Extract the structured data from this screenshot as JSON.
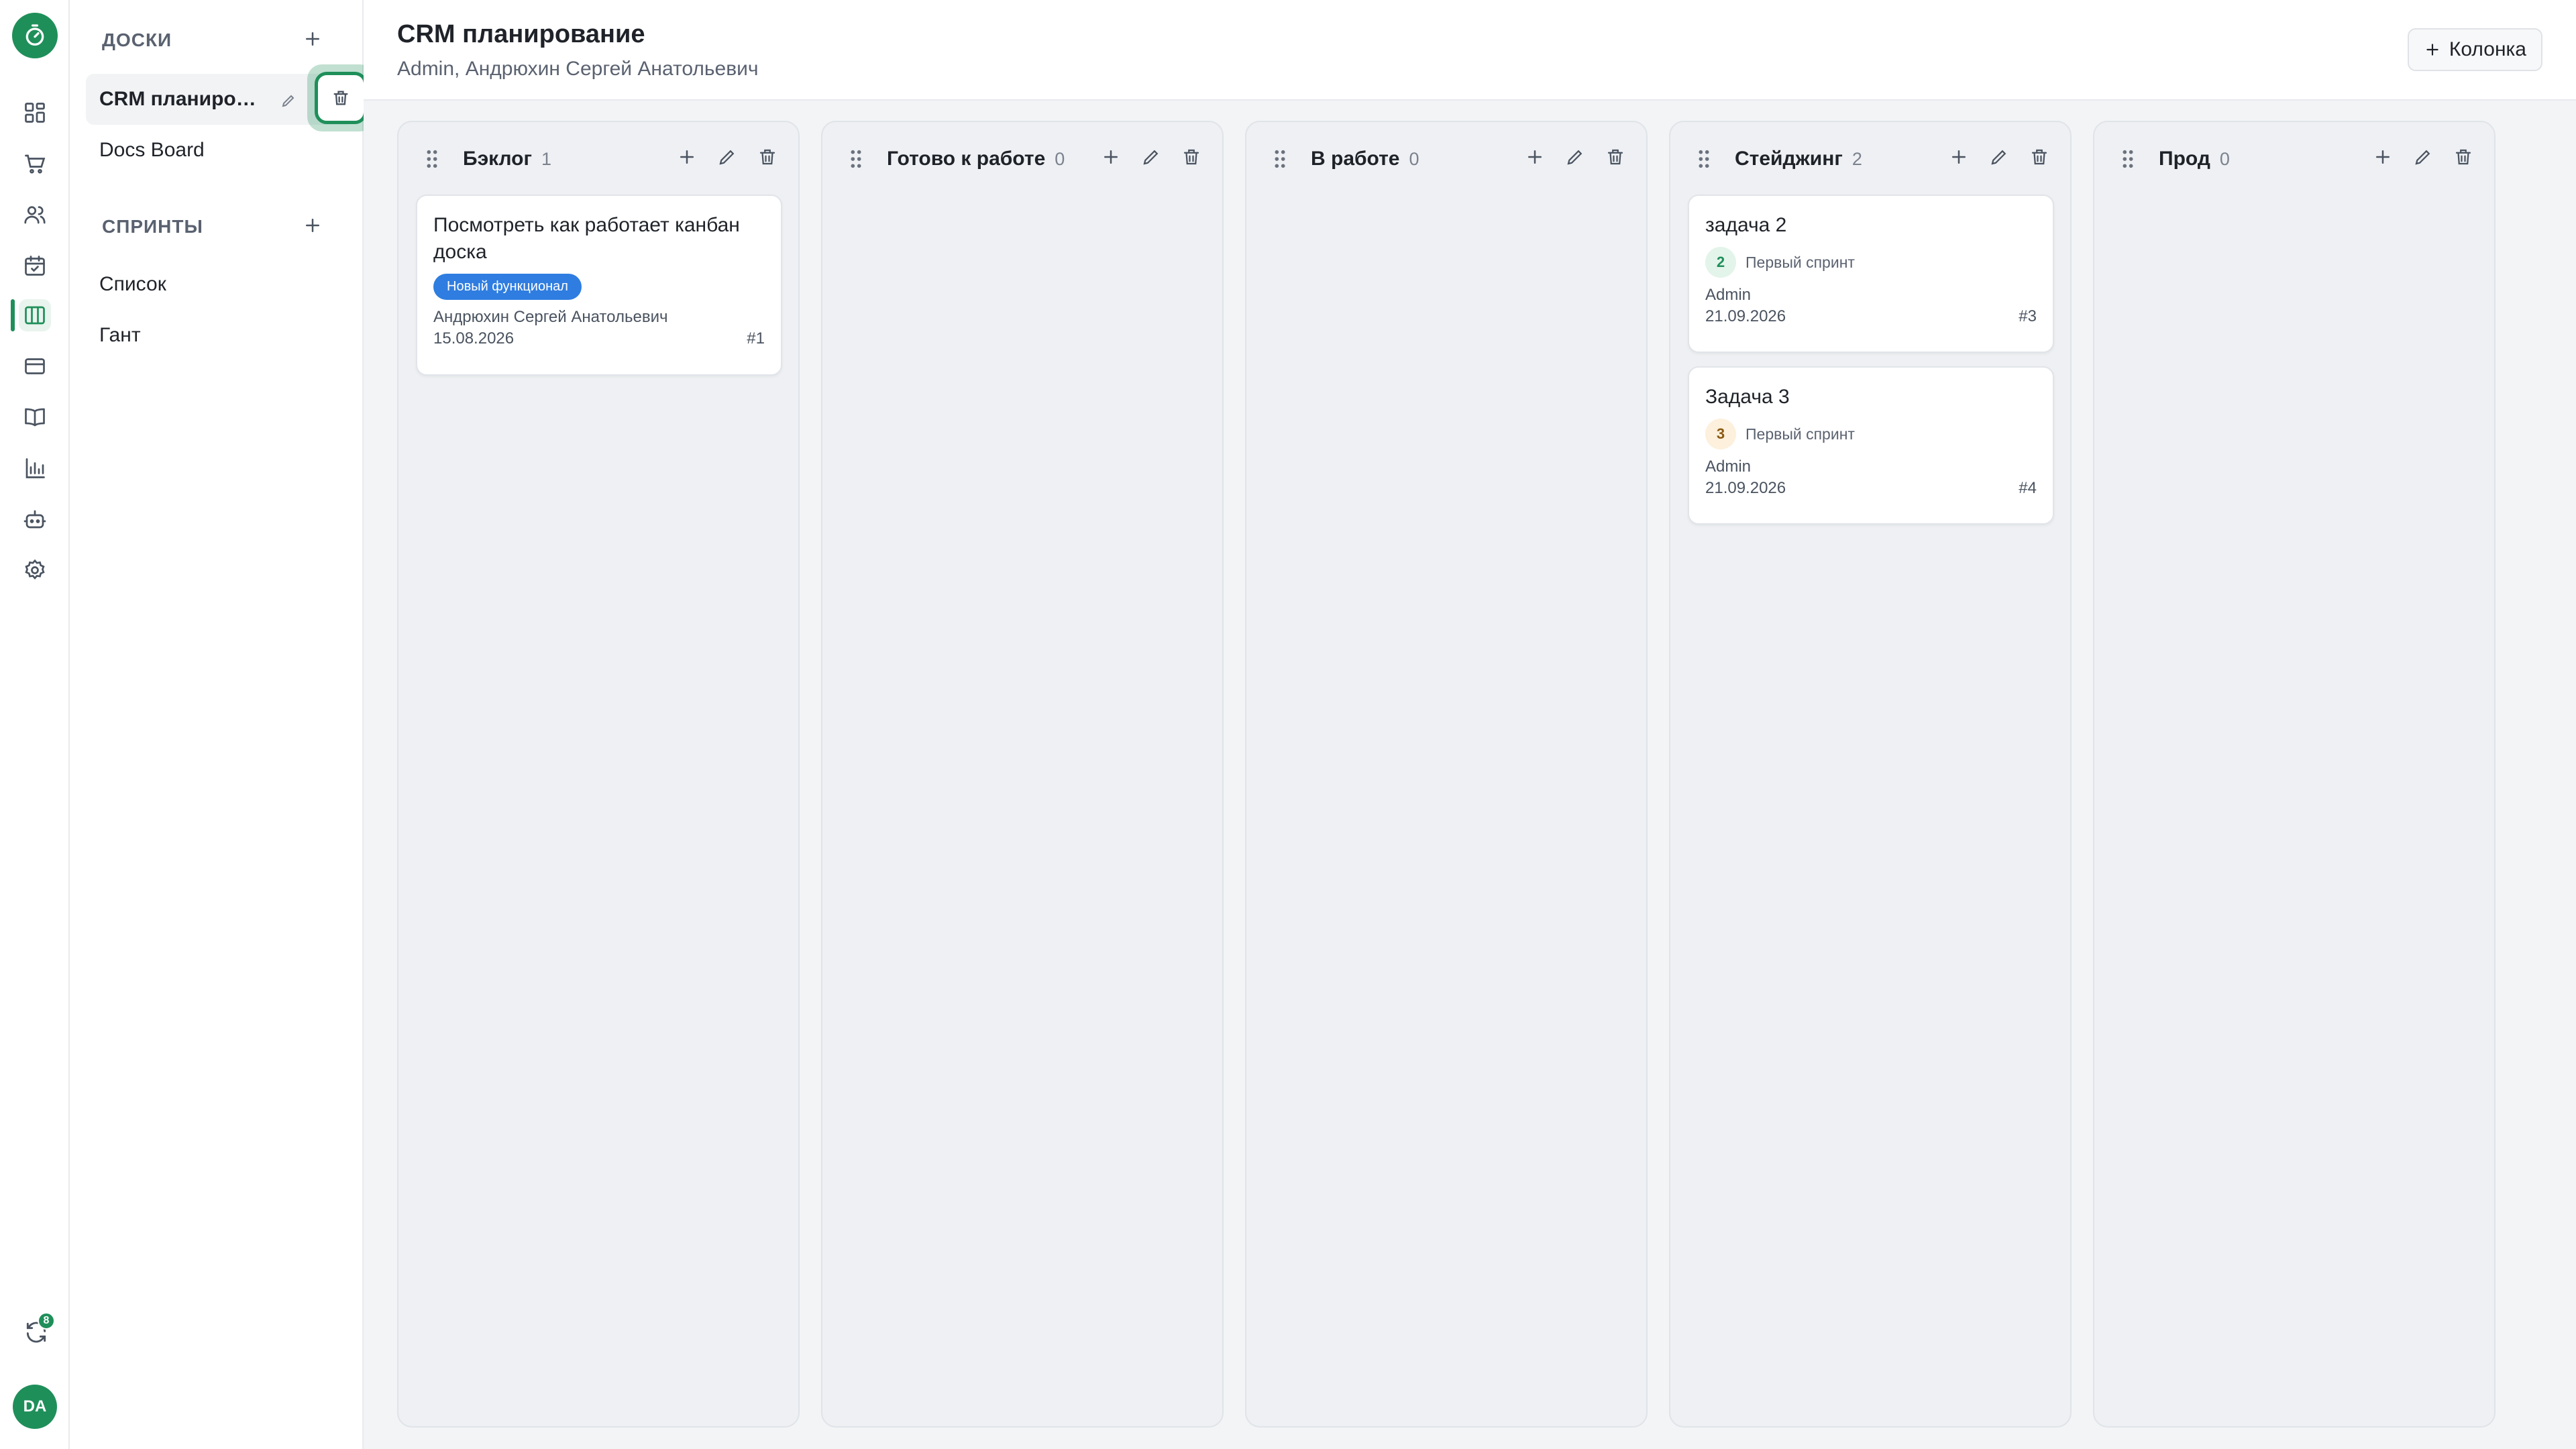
{
  "rail": {
    "logo": "timer-logo-icon",
    "items": [
      {
        "icon": "dashboard-icon"
      },
      {
        "icon": "cart-icon"
      },
      {
        "icon": "users-icon"
      },
      {
        "icon": "calendar-check-icon"
      },
      {
        "icon": "kanban-icon",
        "active": true
      },
      {
        "icon": "card-icon"
      },
      {
        "icon": "book-icon"
      },
      {
        "icon": "bar-chart-icon"
      },
      {
        "icon": "bot-icon"
      },
      {
        "icon": "gear-icon"
      }
    ],
    "sync_badge": "8",
    "avatar_initials": "DA"
  },
  "sidebar": {
    "boards_title": "ДОСКИ",
    "boards": [
      {
        "label": "CRM планирование",
        "selected": true
      },
      {
        "label": "Docs Board",
        "selected": false
      }
    ],
    "sprints_title": "СПРИНТЫ",
    "sprint_links": [
      {
        "label": "Список"
      },
      {
        "label": "Гант"
      }
    ]
  },
  "header": {
    "title": "CRM планирование",
    "subtitle": "Admin, Андрюхин Сергей Анатольевич",
    "add_column_label": "Колонка"
  },
  "columns": [
    {
      "title": "Бэклог",
      "count": "1",
      "cards": [
        {
          "title": "Посмотреть как работает канбан доска",
          "tag": "Новый функционал",
          "assignee": "Андрюхин Сергей Анатольевич",
          "date": "15.08.2026",
          "number": "#1"
        }
      ]
    },
    {
      "title": "Готово к работе",
      "count": "0",
      "cards": []
    },
    {
      "title": "В работе",
      "count": "0",
      "cards": []
    },
    {
      "title": "Стейджинг",
      "count": "2",
      "cards": [
        {
          "title": "задача 2",
          "sprint_badge": "2",
          "sprint_color": "#e3f4ea",
          "sprint_text_color": "#1f8f5a",
          "sprint_name": "Первый спринт",
          "assignee": "Admin",
          "date": "21.09.2026",
          "number": "#3"
        },
        {
          "title": "Задача 3",
          "sprint_badge": "3",
          "sprint_color": "#fdf0dc",
          "sprint_text_color": "#8a5a12",
          "sprint_name": "Первый спринт",
          "assignee": "Admin",
          "date": "21.09.2026",
          "number": "#4"
        }
      ]
    },
    {
      "title": "Прод",
      "count": "0",
      "cards": []
    }
  ],
  "colors": {
    "brand": "#1f8f5a",
    "tag_blue": "#2f7de0",
    "board_bg": "#f3f4f6"
  }
}
